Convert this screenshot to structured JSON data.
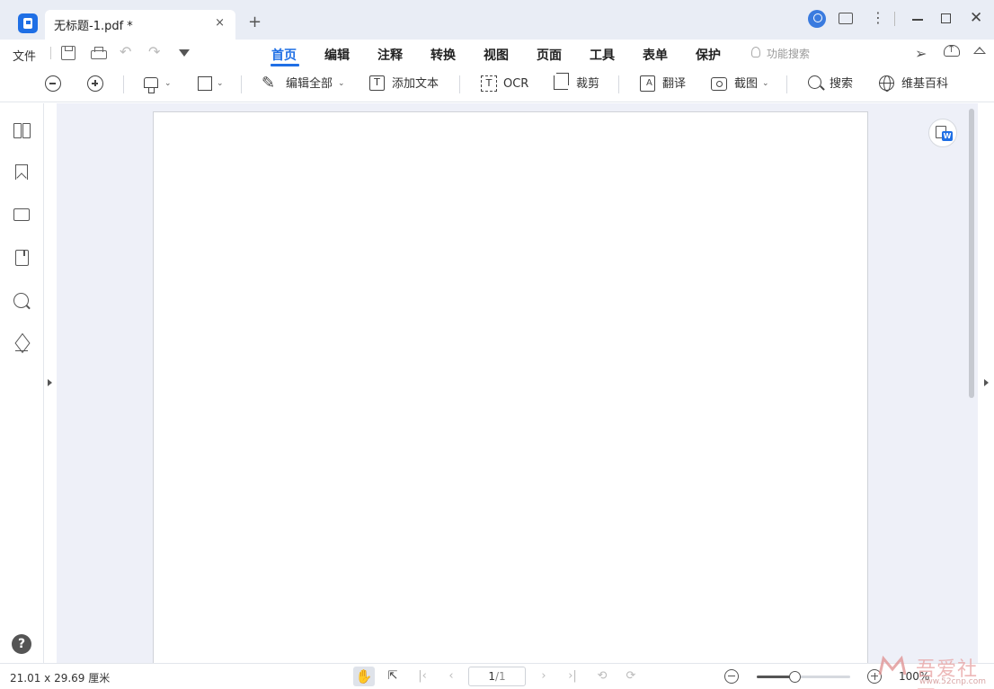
{
  "titlebar": {
    "tab_title": "无标题-1.pdf *",
    "tab_close": "×",
    "new_tab": "+",
    "more": "⋮",
    "close": "✕"
  },
  "menubar": {
    "file": "文件",
    "tabs": [
      "首页",
      "编辑",
      "注释",
      "转换",
      "视图",
      "页面",
      "工具",
      "表单",
      "保护"
    ],
    "active_tab": "首页",
    "feature_search": "功能搜索",
    "undo": "↶",
    "redo": "↷",
    "send": "➢"
  },
  "toolbar": {
    "edit_all": "编辑全部",
    "add_text": "添加文本",
    "ocr": "OCR",
    "crop": "裁剪",
    "translate": "翻译",
    "screenshot": "截图",
    "search": "搜索",
    "wiki": "维基百科",
    "caret": "⌄",
    "textbox_glyph": "T",
    "ocr_glyph": "T"
  },
  "sidebar": {
    "help": "?"
  },
  "statusbar": {
    "page_size": "21.01 x 29.69 厘米",
    "current_page": "1",
    "total_pages": "/1",
    "zoom": "100%",
    "zoom_fraction": 0.4,
    "hand": "✋",
    "select": "⇱",
    "first": "|‹",
    "prev": "‹",
    "next": "›",
    "last": "›|",
    "rotate_left": "⟲",
    "rotate_right": "⟳"
  },
  "watermark": {
    "text": "吾爱社区",
    "url": "www.52cnp.com"
  },
  "colors": {
    "accent": "#1f6fe5",
    "canvas_bg": "#eef0f8",
    "titlebar_bg": "#e9edf5"
  }
}
